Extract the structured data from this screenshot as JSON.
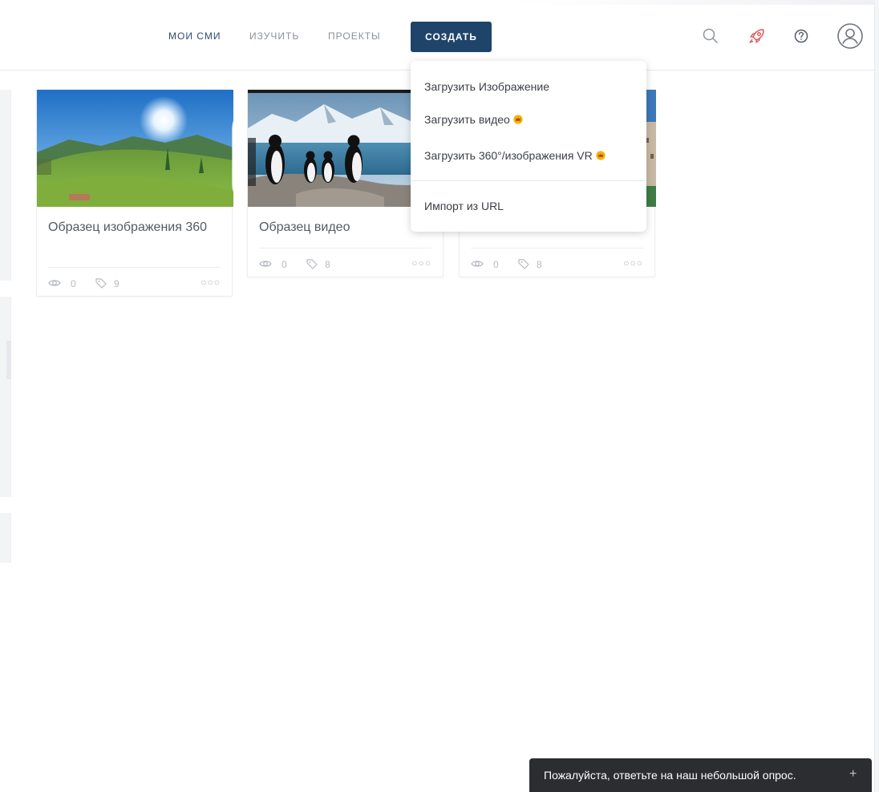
{
  "nav": {
    "items": [
      {
        "label": "МОИ СМИ",
        "active": true
      },
      {
        "label": "ИЗУЧИТЬ",
        "active": false
      },
      {
        "label": "ПРОЕКТЫ",
        "active": false
      }
    ],
    "create_label": "СОЗДАТЬ",
    "icons": [
      "search-icon",
      "rocket-icon",
      "help-icon",
      "user-avatar-icon"
    ],
    "accent_color": "#1f4469"
  },
  "dropdown": {
    "items": [
      {
        "label": "Загрузить Изображение",
        "premium": false
      },
      {
        "label": "Загрузить видео",
        "premium": true
      },
      {
        "label": "Загрузить 360°/изображения VR",
        "premium": true
      }
    ],
    "import_label": "Импорт из URL"
  },
  "cards": [
    {
      "title": "Образец изображения 360",
      "views": "0",
      "tags": "9",
      "badge": "vr-icon"
    },
    {
      "title": "Образец видео",
      "views": "0",
      "tags": "8"
    },
    {
      "title": "",
      "views": "0",
      "tags": "8"
    }
  ],
  "toast": {
    "text": "Пожалуйста, ответьте на наш небольшой опрос.",
    "plus": "+"
  }
}
